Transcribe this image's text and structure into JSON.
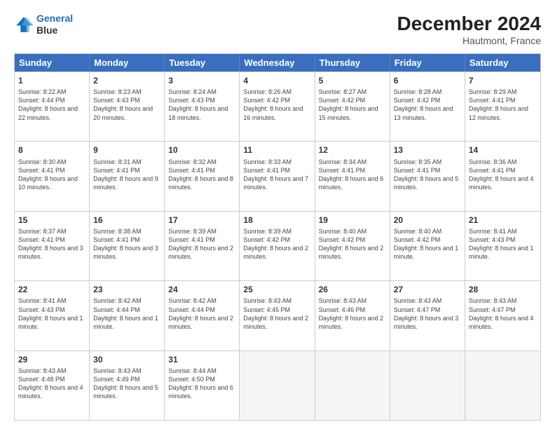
{
  "header": {
    "logo_line1": "General",
    "logo_line2": "Blue",
    "title": "December 2024",
    "subtitle": "Hautmont, France"
  },
  "calendar": {
    "days_of_week": [
      "Sunday",
      "Monday",
      "Tuesday",
      "Wednesday",
      "Thursday",
      "Friday",
      "Saturday"
    ],
    "rows": [
      [
        {
          "day": "1",
          "text": "Sunrise: 8:22 AM\nSunset: 4:44 PM\nDaylight: 8 hours and 22 minutes."
        },
        {
          "day": "2",
          "text": "Sunrise: 8:23 AM\nSunset: 4:43 PM\nDaylight: 8 hours and 20 minutes."
        },
        {
          "day": "3",
          "text": "Sunrise: 8:24 AM\nSunset: 4:43 PM\nDaylight: 8 hours and 18 minutes."
        },
        {
          "day": "4",
          "text": "Sunrise: 8:26 AM\nSunset: 4:42 PM\nDaylight: 8 hours and 16 minutes."
        },
        {
          "day": "5",
          "text": "Sunrise: 8:27 AM\nSunset: 4:42 PM\nDaylight: 8 hours and 15 minutes."
        },
        {
          "day": "6",
          "text": "Sunrise: 8:28 AM\nSunset: 4:42 PM\nDaylight: 8 hours and 13 minutes."
        },
        {
          "day": "7",
          "text": "Sunrise: 8:29 AM\nSunset: 4:41 PM\nDaylight: 8 hours and 12 minutes."
        }
      ],
      [
        {
          "day": "8",
          "text": "Sunrise: 8:30 AM\nSunset: 4:41 PM\nDaylight: 8 hours and 10 minutes."
        },
        {
          "day": "9",
          "text": "Sunrise: 8:31 AM\nSunset: 4:41 PM\nDaylight: 8 hours and 9 minutes."
        },
        {
          "day": "10",
          "text": "Sunrise: 8:32 AM\nSunset: 4:41 PM\nDaylight: 8 hours and 8 minutes."
        },
        {
          "day": "11",
          "text": "Sunrise: 8:33 AM\nSunset: 4:41 PM\nDaylight: 8 hours and 7 minutes."
        },
        {
          "day": "12",
          "text": "Sunrise: 8:34 AM\nSunset: 4:41 PM\nDaylight: 8 hours and 6 minutes."
        },
        {
          "day": "13",
          "text": "Sunrise: 8:35 AM\nSunset: 4:41 PM\nDaylight: 8 hours and 5 minutes."
        },
        {
          "day": "14",
          "text": "Sunrise: 8:36 AM\nSunset: 4:41 PM\nDaylight: 8 hours and 4 minutes."
        }
      ],
      [
        {
          "day": "15",
          "text": "Sunrise: 8:37 AM\nSunset: 4:41 PM\nDaylight: 8 hours and 3 minutes."
        },
        {
          "day": "16",
          "text": "Sunrise: 8:38 AM\nSunset: 4:41 PM\nDaylight: 8 hours and 3 minutes."
        },
        {
          "day": "17",
          "text": "Sunrise: 8:39 AM\nSunset: 4:41 PM\nDaylight: 8 hours and 2 minutes."
        },
        {
          "day": "18",
          "text": "Sunrise: 8:39 AM\nSunset: 4:42 PM\nDaylight: 8 hours and 2 minutes."
        },
        {
          "day": "19",
          "text": "Sunrise: 8:40 AM\nSunset: 4:42 PM\nDaylight: 8 hours and 2 minutes."
        },
        {
          "day": "20",
          "text": "Sunrise: 8:40 AM\nSunset: 4:42 PM\nDaylight: 8 hours and 1 minute."
        },
        {
          "day": "21",
          "text": "Sunrise: 8:41 AM\nSunset: 4:43 PM\nDaylight: 8 hours and 1 minute."
        }
      ],
      [
        {
          "day": "22",
          "text": "Sunrise: 8:41 AM\nSunset: 4:43 PM\nDaylight: 8 hours and 1 minute."
        },
        {
          "day": "23",
          "text": "Sunrise: 8:42 AM\nSunset: 4:44 PM\nDaylight: 8 hours and 1 minute."
        },
        {
          "day": "24",
          "text": "Sunrise: 8:42 AM\nSunset: 4:44 PM\nDaylight: 8 hours and 2 minutes."
        },
        {
          "day": "25",
          "text": "Sunrise: 8:43 AM\nSunset: 4:45 PM\nDaylight: 8 hours and 2 minutes."
        },
        {
          "day": "26",
          "text": "Sunrise: 8:43 AM\nSunset: 4:46 PM\nDaylight: 8 hours and 2 minutes."
        },
        {
          "day": "27",
          "text": "Sunrise: 8:43 AM\nSunset: 4:47 PM\nDaylight: 8 hours and 3 minutes."
        },
        {
          "day": "28",
          "text": "Sunrise: 8:43 AM\nSunset: 4:47 PM\nDaylight: 8 hours and 4 minutes."
        }
      ],
      [
        {
          "day": "29",
          "text": "Sunrise: 8:43 AM\nSunset: 4:48 PM\nDaylight: 8 hours and 4 minutes."
        },
        {
          "day": "30",
          "text": "Sunrise: 8:43 AM\nSunset: 4:49 PM\nDaylight: 8 hours and 5 minutes."
        },
        {
          "day": "31",
          "text": "Sunrise: 8:44 AM\nSunset: 4:50 PM\nDaylight: 8 hours and 6 minutes."
        },
        {
          "day": "",
          "text": "",
          "empty": true
        },
        {
          "day": "",
          "text": "",
          "empty": true
        },
        {
          "day": "",
          "text": "",
          "empty": true
        },
        {
          "day": "",
          "text": "",
          "empty": true
        }
      ]
    ]
  }
}
